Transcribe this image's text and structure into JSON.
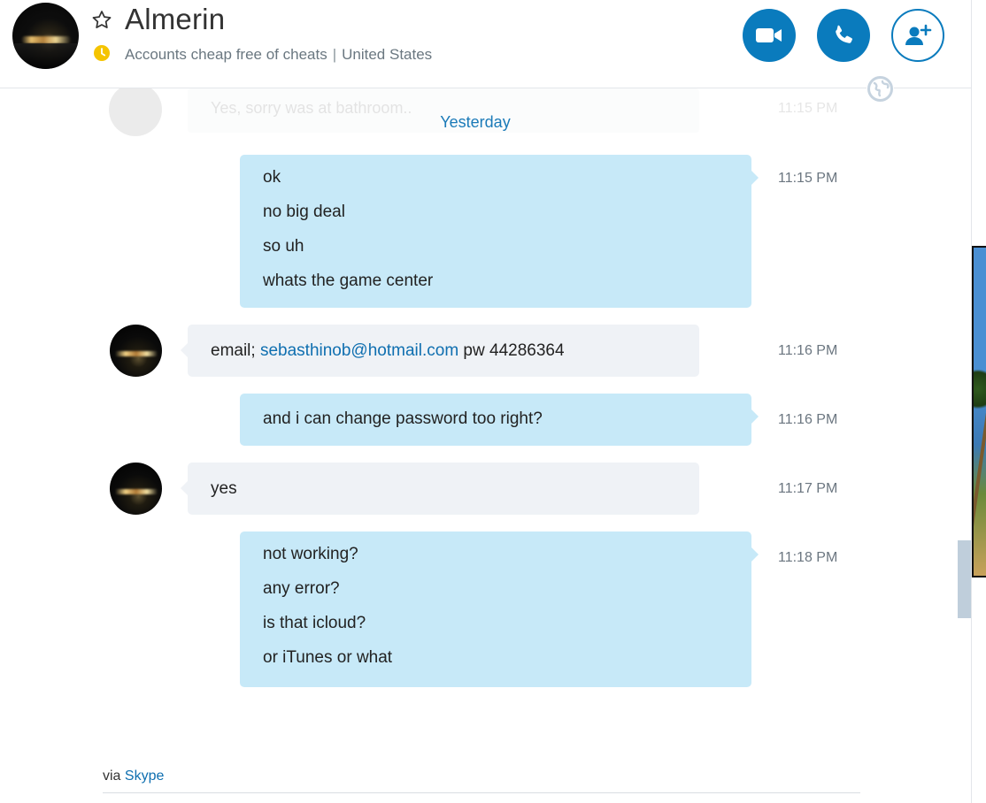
{
  "header": {
    "contact_name": "Almerin",
    "mood": "Accounts cheap free of cheats",
    "separator": "|",
    "location": "United States",
    "status": "away",
    "status_color": "#f5c400",
    "buttons": {
      "video_call": "video-camera-icon",
      "voice_call": "phone-icon",
      "add_people": "add-contact-icon"
    }
  },
  "conversation": {
    "faded_preview": {
      "text": "Yes, sorry was at bathroom..",
      "time": "11:15 PM"
    },
    "day_separator": "Yesterday",
    "messages": [
      {
        "direction": "out",
        "lines": [
          "ok",
          "no big deal",
          "so uh",
          "whats the game center"
        ],
        "time": "11:15 PM"
      },
      {
        "direction": "in",
        "prefix": "email; ",
        "link": "sebasthinob@hotmail.com",
        "suffix": " pw 44286364",
        "time": "11:16 PM"
      },
      {
        "direction": "out",
        "lines": [
          "and i can change password too right?"
        ],
        "time": "11:16 PM"
      },
      {
        "direction": "in",
        "lines": [
          "yes"
        ],
        "time": "11:17 PM"
      },
      {
        "direction": "out",
        "lines": [
          "not working?",
          "any error?",
          "is that icloud?",
          "or iTunes or what"
        ],
        "time": "11:18 PM"
      }
    ]
  },
  "footer": {
    "via_label": "via",
    "via_link": "Skype"
  },
  "colors": {
    "accent": "#0a7bbd",
    "outgoing_bubble": "#c7e9f8",
    "incoming_bubble": "#eff2f6",
    "link": "#0f6fb0"
  }
}
